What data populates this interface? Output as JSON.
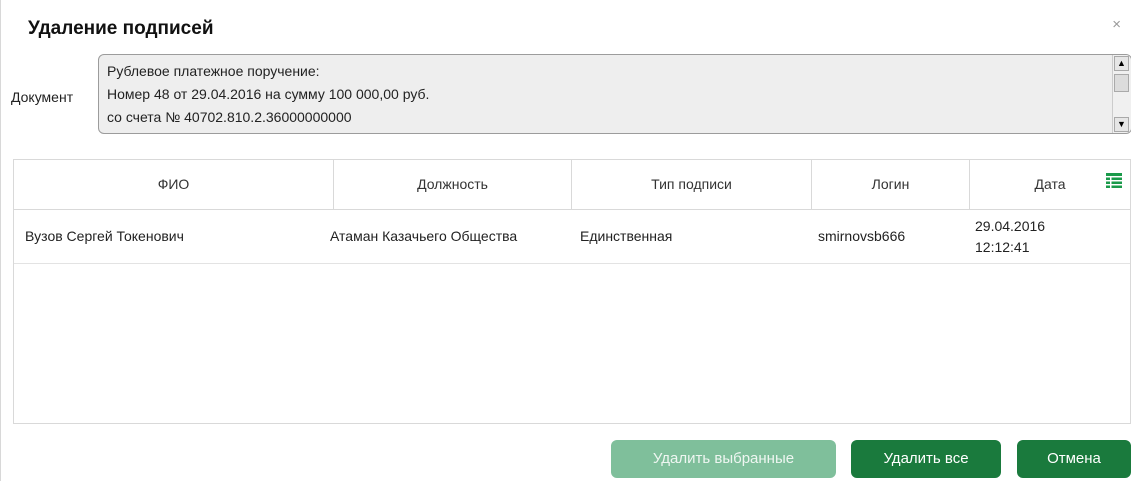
{
  "dialog": {
    "title": "Удаление подписей",
    "close_label": "×"
  },
  "document": {
    "label": "Документ",
    "text": "Рублевое платежное поручение:\nНомер 48 от 29.04.2016 на сумму 100 000,00 руб.\nсо счета № 40702.810.2.36000000000"
  },
  "table": {
    "columns": [
      "ФИО",
      "Должность",
      "Тип подписи",
      "Логин",
      "Дата"
    ],
    "rows": [
      {
        "fio": "Вузов Сергей Токенович",
        "position": "Атаман Казачьего Общества",
        "sign_type": "Единственная",
        "login": "smirnovsb666",
        "date": "29.04.2016",
        "time": "12:12:41"
      }
    ]
  },
  "buttons": {
    "delete_selected": "Удалить выбранные",
    "delete_all": "Удалить все",
    "cancel": "Отмена"
  },
  "colors": {
    "primary": "#1a7a3d",
    "disabled": "#7fbf9b",
    "icon": "#1a9a4a"
  },
  "icons": {
    "close": "close-icon",
    "columns": "column-settings-icon",
    "scroll_up": "arrow-up-icon",
    "scroll_down": "arrow-down-icon"
  }
}
